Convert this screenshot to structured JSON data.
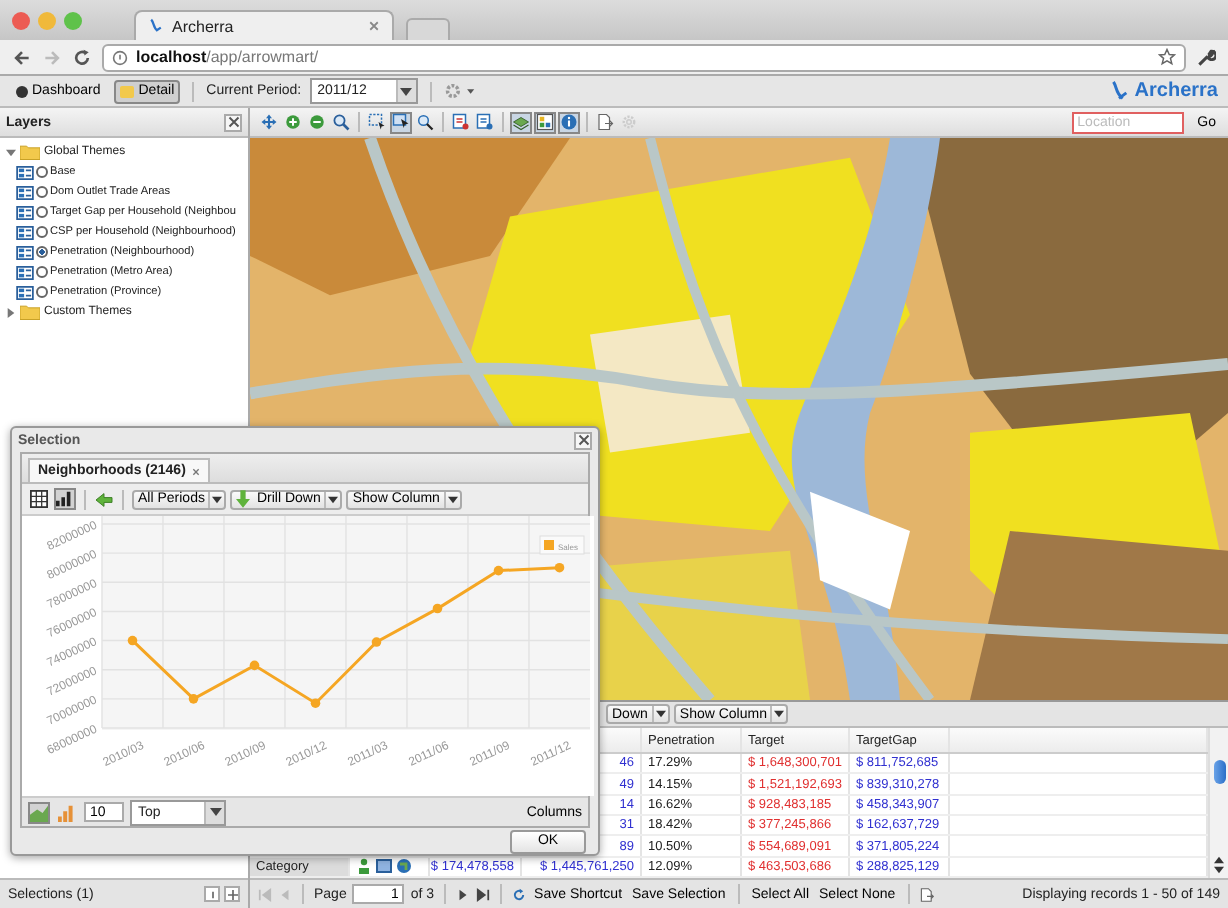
{
  "browser": {
    "tab_title": "Archerra",
    "url": "**localhost**/app/arrowmart/"
  },
  "app_toolbar": {
    "views": [
      {
        "label": "Dashboard",
        "selected": false
      },
      {
        "label": "Detail",
        "selected": true
      }
    ],
    "period_label": "Current Period:",
    "period": "2011/12",
    "brand": "Archerra"
  },
  "layers": {
    "title": "Layers",
    "groups": [
      {
        "label": "Global Themes",
        "expanded": true,
        "children": [
          {
            "label": "Base",
            "selected": false
          },
          {
            "label": "Dom Outlet Trade Areas",
            "selected": false
          },
          {
            "label": "Target Gap per Household (Neighbou",
            "selected": false
          },
          {
            "label": "CSP per Household (Neighbourhood)",
            "selected": false
          },
          {
            "label": "Penetration (Neighbourhood)",
            "selected": true
          },
          {
            "label": "Penetration (Metro Area)",
            "selected": false
          },
          {
            "label": "Penetration (Province)",
            "selected": false
          }
        ]
      },
      {
        "label": "Custom Themes",
        "expanded": false
      }
    ]
  },
  "map_toolbar": {
    "tools": [
      {
        "kind": "pan",
        "selected": false
      },
      {
        "kind": "zoom-in",
        "selected": false
      },
      {
        "kind": "zoom-out",
        "selected": false
      },
      {
        "kind": "zoom",
        "selected": false
      },
      {
        "kind": "select-box",
        "selected": false
      },
      {
        "kind": "select-pointer",
        "selected": true
      },
      {
        "kind": "select-zoom",
        "selected": false
      },
      {
        "kind": "report",
        "selected": false
      },
      {
        "kind": "report-zoom",
        "selected": false
      },
      {
        "kind": "layers",
        "selected": true
      },
      {
        "kind": "legend",
        "selected": true
      },
      {
        "kind": "info",
        "selected": true
      },
      {
        "kind": "export",
        "selected": false
      },
      {
        "kind": "settings",
        "selected": false
      }
    ],
    "location_placeholder": "Location",
    "go": "Go"
  },
  "grid": {
    "menus": [
      "Down",
      "Show Column"
    ],
    "columns": [
      "Penetration",
      "Target",
      "TargetGap"
    ],
    "rows": [
      {
        "sales": "46",
        "penetration": "17.29%",
        "target": "$ 1,648,300,701",
        "target_gap": "$ 811,752,685"
      },
      {
        "sales": "49",
        "penetration": "14.15%",
        "target": "$ 1,521,192,693",
        "target_gap": "$ 839,310,278"
      },
      {
        "sales": "14",
        "penetration": "16.62%",
        "target": "$ 928,483,185",
        "target_gap": "$ 458,343,907"
      },
      {
        "sales": "31",
        "penetration": "18.42%",
        "target": "$ 377,245,866",
        "target_gap": "$ 162,637,729"
      },
      {
        "sales": "89",
        "penetration": "10.50%",
        "target": "$ 554,689,091",
        "target_gap": "$ 371,805,224"
      },
      {
        "category": "Category",
        "value": "$ 174,478,558",
        "sales": "$ 1,445,761,250",
        "penetration": "12.09%",
        "target": "$ 463,503,686",
        "target_gap": "$ 288,825,129"
      }
    ]
  },
  "pager": {
    "page_label": "Page",
    "page": "1",
    "page_count": "of 3",
    "actions": [
      "Save Shortcut",
      "Save Selection",
      "Select All",
      "Select None"
    ],
    "summary": "Displaying records 1 - 50 of 149"
  },
  "selections": {
    "label": "Selections (1)"
  },
  "dialog": {
    "title": "Selection",
    "tabs": [
      {
        "label": "Neighborhoods (2146)",
        "selected": true
      }
    ],
    "views": [
      {
        "kind": "table",
        "selected": false
      },
      {
        "kind": "chart",
        "selected": true
      }
    ],
    "menus": [
      {
        "label": "All Periods",
        "kind": "plain"
      },
      {
        "label": "Drill Down",
        "kind": "drill"
      },
      {
        "label": "Show Column",
        "kind": "plain"
      }
    ],
    "chart_data": {
      "type": "line",
      "categories": [
        "2010/03",
        "2010/06",
        "2010/09",
        "2010/12",
        "2011/03",
        "2011/06",
        "2011/09",
        "2011/12"
      ],
      "series": [
        {
          "name": "Sales",
          "color": "#f5a623",
          "values": [
            74000000,
            70000000,
            72300000,
            69700000,
            73900000,
            76200000,
            78800000,
            79000000
          ]
        }
      ],
      "grid": true,
      "marker": true,
      "ylim": [
        68000000,
        82000000
      ],
      "yticks": [
        68000000,
        70000000,
        72000000,
        74000000,
        76000000,
        78000000,
        80000000,
        82000000
      ]
    },
    "chart_types": [
      {
        "kind": "area",
        "selected": true
      },
      {
        "kind": "bar",
        "selected": false
      }
    ],
    "top_count": "10",
    "top_mode": "Top",
    "columns_label": "Columns",
    "ok": "OK"
  }
}
